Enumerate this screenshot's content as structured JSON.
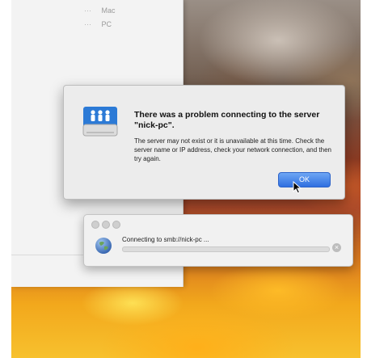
{
  "finder": {
    "items": [
      "Mac",
      "PC"
    ],
    "item_prefix": "···"
  },
  "alert": {
    "icon": "network-server-icon",
    "title": "There was a problem connecting to the server \"nick-pc\".",
    "message": "The server may not exist or it is unavailable at this time. Check the server name or IP address, check your network connection, and then try again.",
    "ok_label": "OK"
  },
  "connection": {
    "icon": "globe-icon",
    "status_text": "Connecting to smb://nick-pc ...",
    "progress": 0.0,
    "cancel_glyph": "×"
  },
  "colors": {
    "ok_button": "#2f6fe0",
    "dialog_background": "#ececec"
  }
}
